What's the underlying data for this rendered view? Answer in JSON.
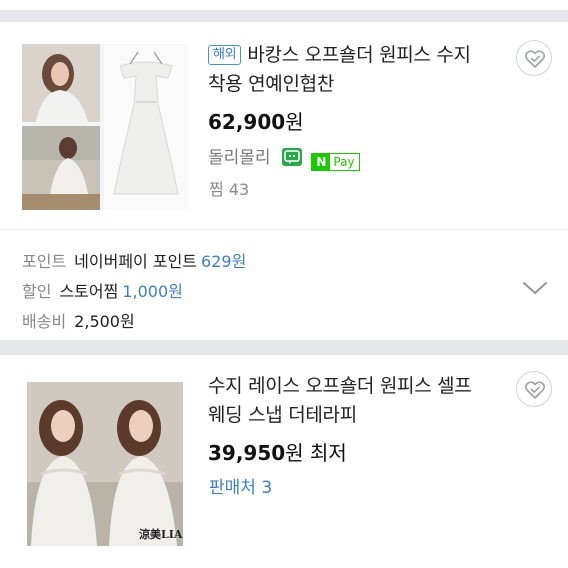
{
  "products": [
    {
      "abroad_tag": "해외",
      "title_line1": "바캉스 오프숄더 원피스 수지",
      "title_line2": "착용 연예인협찬",
      "price_amount": "62,900",
      "price_unit": "원",
      "seller": "돌리몰리",
      "npay_n": "N",
      "npay_label": "Pay",
      "zzim": "찜 43",
      "point_label": "포인트",
      "point_text": "네이버페이 포인트",
      "point_value": "629원",
      "discount_label": "할인",
      "discount_text": "스토어찜",
      "discount_value": "1,000원",
      "shipping_label": "배송비",
      "shipping_value": "2,500원"
    },
    {
      "title_line1": "수지 레이스 오프숄더 원피스 셀프",
      "title_line2": "웨딩 스냅 더테라피",
      "price_amount": "39,950",
      "price_unit": "원 최저",
      "sellers_link": "판매처 3",
      "image_watermark": "涼美LIA"
    }
  ],
  "icons": {
    "wishlist": "heart-check-icon",
    "talk": "talktalk-icon",
    "npay": "npay-icon",
    "expand": "chevron-down-icon"
  },
  "colors": {
    "accent_blue": "#3f7fc0",
    "npay_green": "#1ec800",
    "background": "#e6e7ea"
  }
}
